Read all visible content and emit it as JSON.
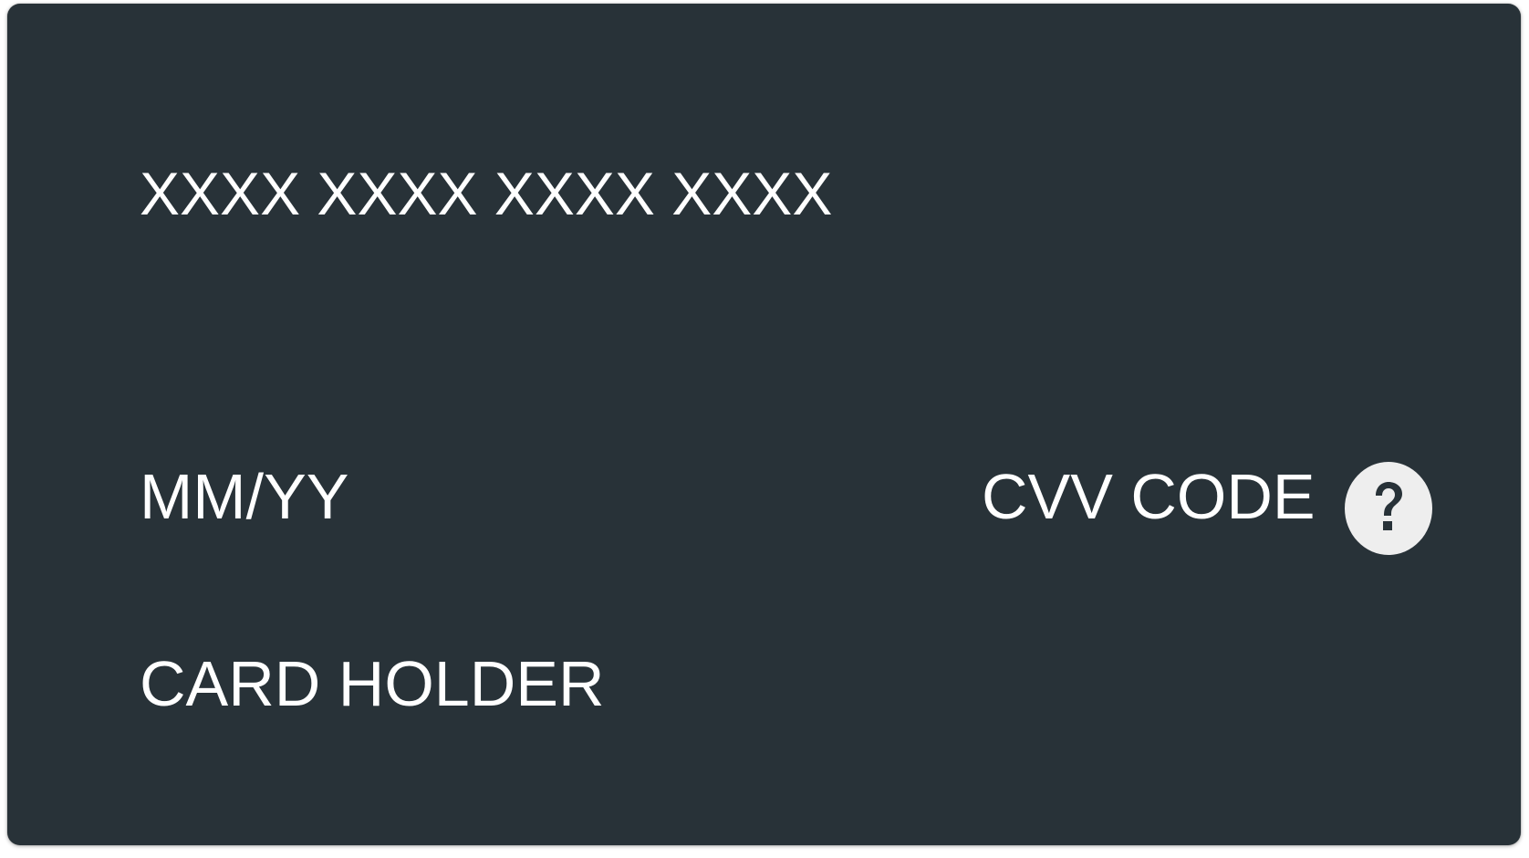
{
  "card": {
    "number_placeholder": "XXXX XXXX XXXX XXXX",
    "expiry_placeholder": "MM/YY",
    "cvv_placeholder": "CVV CODE",
    "holder_placeholder": "CARD HOLDER",
    "help_icon": "question-mark-icon"
  },
  "colors": {
    "card_background": "#283238",
    "text": "#ffffff",
    "help_button_background": "#eeeeee",
    "help_icon_color": "#283238"
  }
}
